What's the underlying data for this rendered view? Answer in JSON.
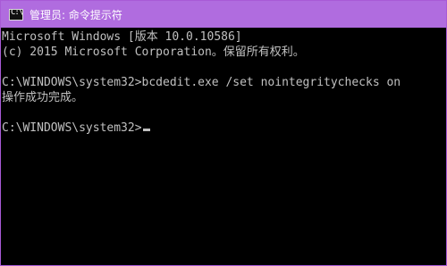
{
  "window": {
    "title": "管理员: 命令提示符",
    "icon": "cmd-icon",
    "icon_glyph": "C:\\",
    "accent_color": "#b06cdf"
  },
  "console": {
    "lines": [
      "Microsoft Windows [版本 10.0.10586]",
      "(c) 2015 Microsoft Corporation。保留所有权利。",
      "",
      "C:\\WINDOWS\\system32>bcdedit.exe /set nointegritychecks on",
      "操作成功完成。",
      "",
      "C:\\WINDOWS\\system32>"
    ]
  }
}
